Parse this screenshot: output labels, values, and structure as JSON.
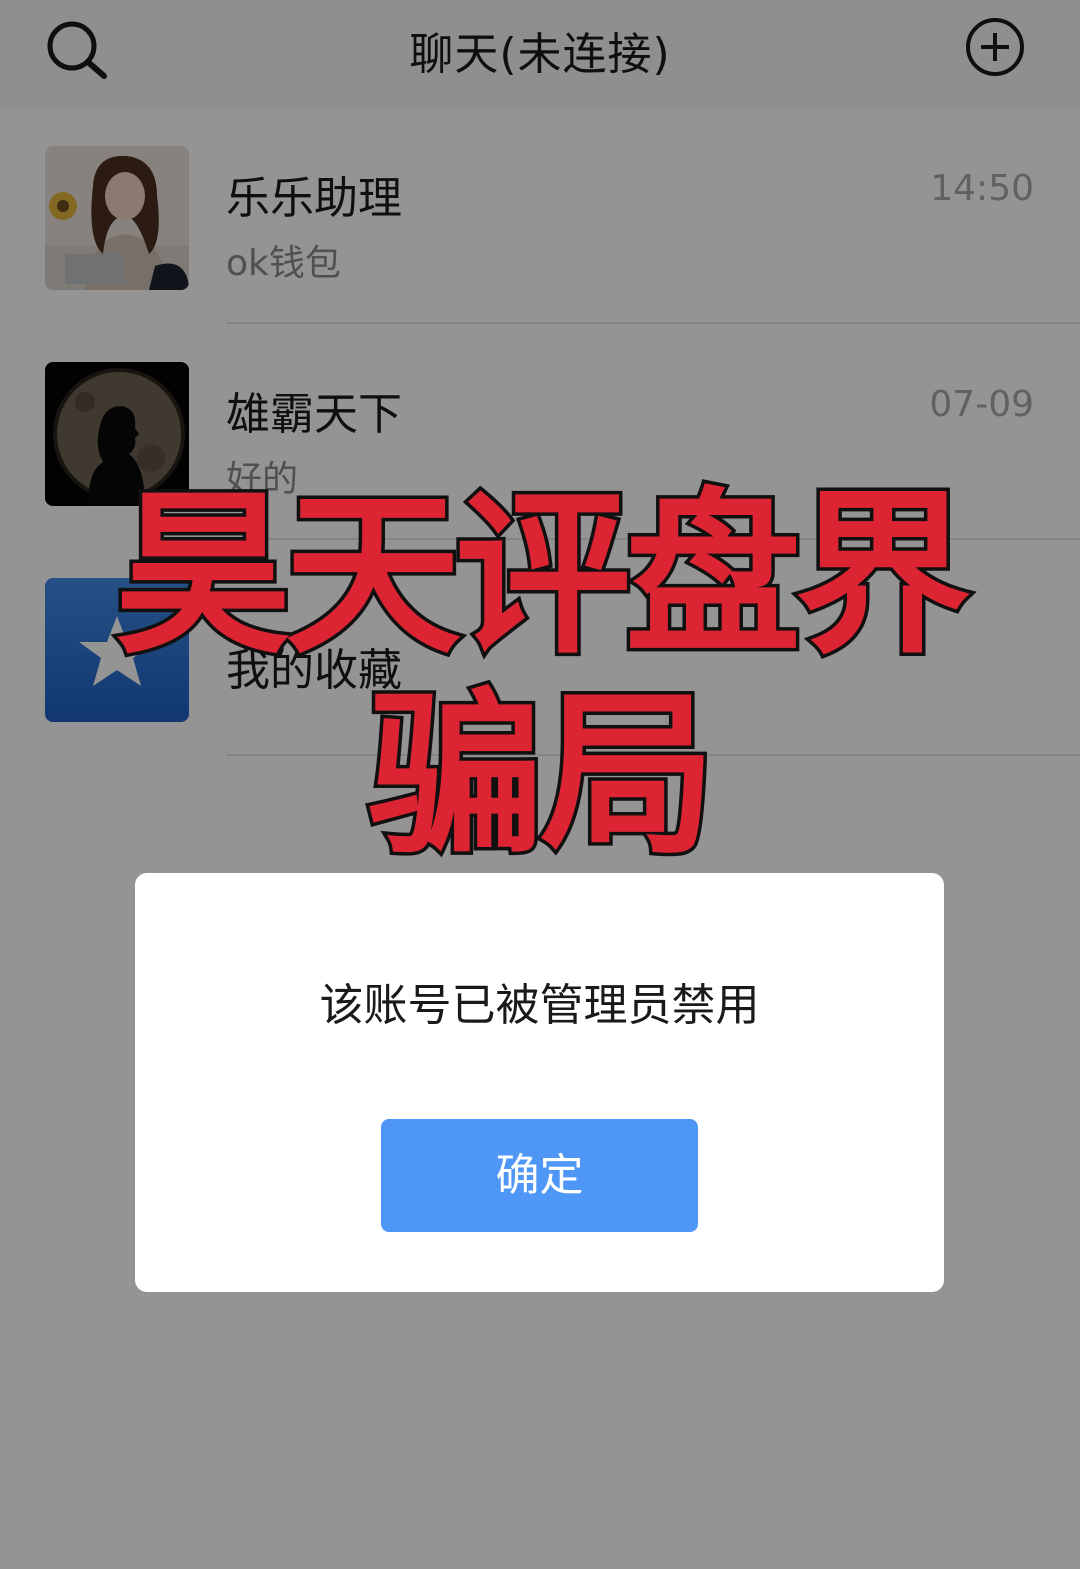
{
  "header": {
    "title": "聊天(未连接)",
    "search_icon": "search-icon",
    "add_icon": "plus-circle-icon"
  },
  "chats": [
    {
      "name": "乐乐助理",
      "preview": "ok钱包",
      "time": "14:50",
      "avatar": "girl-avatar"
    },
    {
      "name": "雄霸天下",
      "preview": "好的",
      "time": "07-09",
      "avatar": "silhouette-moon-avatar"
    },
    {
      "name": "我的收藏",
      "preview": "",
      "time": "",
      "avatar": "star-avatar"
    }
  ],
  "banner": {
    "line1": "昊天评盘界",
    "line2": "骗局"
  },
  "dialog": {
    "message": "该账号已被管理员禁用",
    "confirm_label": "确定"
  },
  "colors": {
    "header_bg": "#f7f7f7",
    "banner_red": "#dc2433",
    "button_blue": "#4f97f7",
    "overlay": "rgba(0,0,0,0.42)"
  }
}
